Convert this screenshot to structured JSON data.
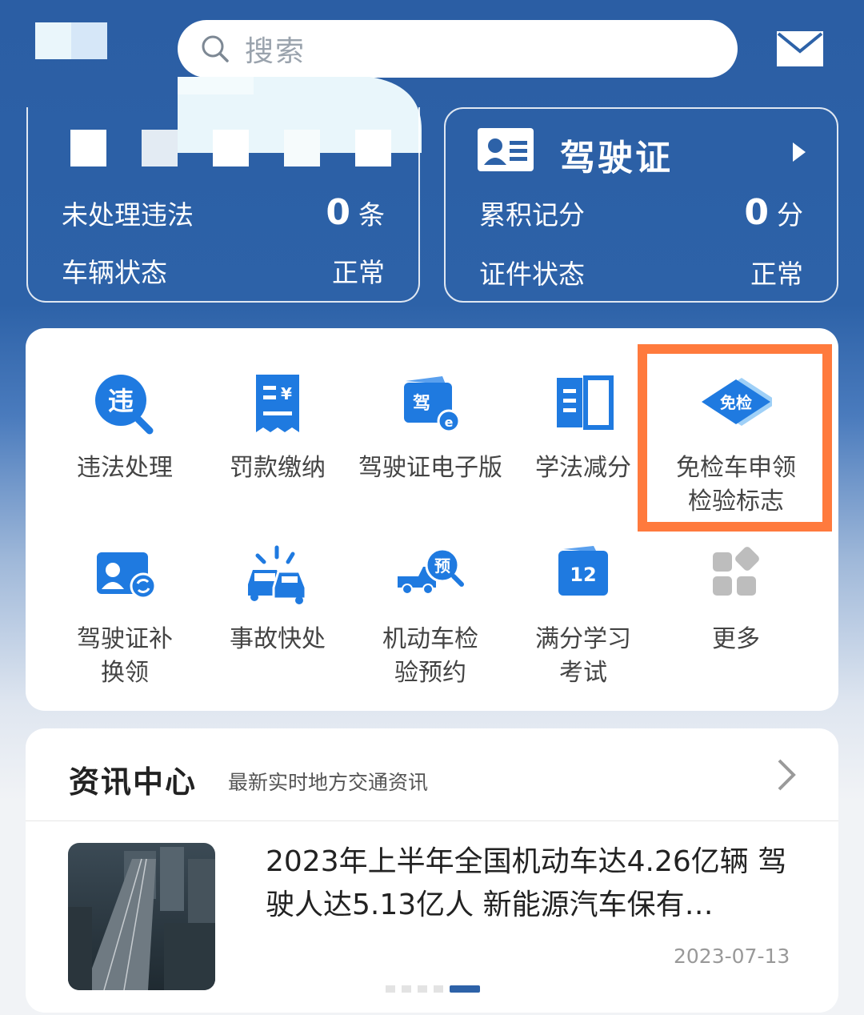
{
  "header": {
    "search_placeholder": "搜索"
  },
  "vehicle_card": {
    "violations_label": "未处理违法",
    "violations_count": "0",
    "violations_unit": "条",
    "status_label": "车辆状态",
    "status_value": "正常"
  },
  "license_card": {
    "title": "驾驶证",
    "points_label": "累积记分",
    "points_value": "0",
    "points_unit": "分",
    "status_label": "证件状态",
    "status_value": "正常"
  },
  "services": [
    {
      "label": "违法处理",
      "icon": "violation-icon"
    },
    {
      "label": "罚款缴纳",
      "icon": "fine-receipt-icon"
    },
    {
      "label": "驾驶证电子版",
      "icon": "e-license-icon"
    },
    {
      "label": "学法减分",
      "icon": "book-icon"
    },
    {
      "label": "免检车申领检验标志",
      "icon": "exempt-diamond-icon",
      "badge": "免检"
    },
    {
      "label": "驾驶证补换领",
      "icon": "license-exchange-icon"
    },
    {
      "label": "事故快处",
      "icon": "accident-icon"
    },
    {
      "label": "机动车检验预约",
      "icon": "inspection-booking-icon",
      "badge": "预"
    },
    {
      "label": "满分学习考试",
      "icon": "calendar-12-icon",
      "badge": "12"
    },
    {
      "label": "更多",
      "icon": "more-grid-icon"
    }
  ],
  "news": {
    "title": "资讯中心",
    "subtitle": "最新实时地方交通资讯",
    "headline": "2023年上半年全国机动车达4.26亿辆 驾驶人达5.13亿人 新能源汽车保有…",
    "date": "2023-07-13"
  },
  "colors": {
    "brand_blue": "#2d62a8",
    "icon_blue": "#1f7ae0",
    "highlight": "#ff7a3d"
  }
}
